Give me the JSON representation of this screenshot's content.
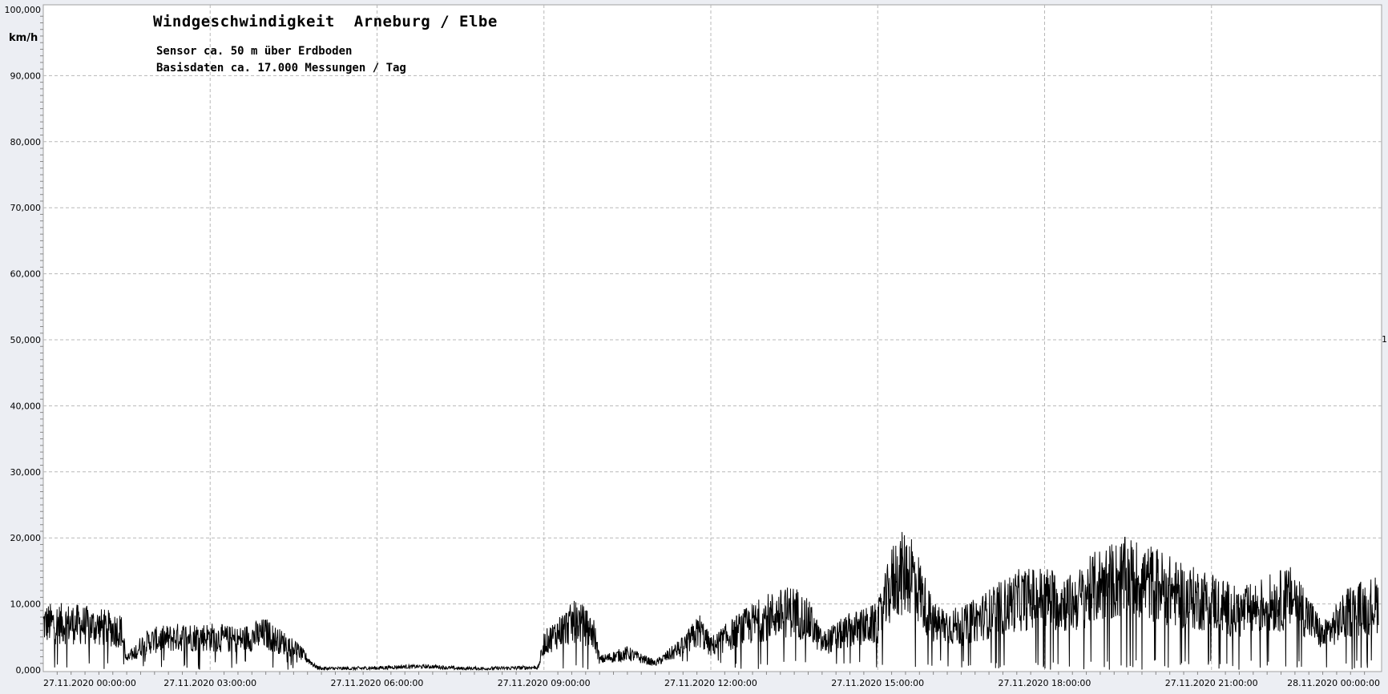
{
  "chart_data": {
    "type": "line",
    "title": "Windgeschwindigkeit  Arneburg / Elbe",
    "subtitle_lines": [
      "Sensor ca. 50 m über Erdboden",
      "Basisdaten ca. 17.000 Messungen / Tag"
    ],
    "ylabel": "km/h",
    "ylim": [
      0,
      100
    ],
    "y_ticks": [
      "0,000",
      "10,000",
      "20,000",
      "30,000",
      "40,000",
      "50,000",
      "60,000",
      "70,000",
      "80,000",
      "90,000",
      "100,000"
    ],
    "x_ticks": [
      "27.11.2020  00:00:00",
      "27.11.2020  03:00:00",
      "27.11.2020  06:00:00",
      "27.11.2020  09:00:00",
      "27.11.2020  12:00:00",
      "27.11.2020  15:00:00",
      "27.11.2020  18:00:00",
      "27.11.2020  21:00:00",
      "28.11.2020  00:00:00"
    ],
    "xlim_hours": [
      0,
      24
    ],
    "grid": true,
    "right_axis_marker": "1",
    "series": [
      {
        "color": "#000000",
        "x_hours": [
          0,
          0.5,
          1,
          1.4,
          1.5,
          1.8,
          2,
          2.5,
          3,
          3.5,
          4,
          4.2,
          4.5,
          4.9,
          5,
          5.5,
          6,
          6.5,
          7,
          7.5,
          8,
          8.5,
          8.9,
          9,
          9.3,
          9.6,
          9.9,
          10,
          10.5,
          11,
          11.5,
          11.8,
          12,
          12.5,
          13,
          13.5,
          13.8,
          14,
          14.5,
          15,
          15.3,
          15.6,
          16,
          16.5,
          17,
          17.5,
          18,
          18.5,
          19,
          19.5,
          20,
          20.5,
          21,
          21.5,
          22,
          22.5,
          23,
          23.5,
          24
        ],
        "values": [
          7,
          7,
          6.5,
          6,
          1.5,
          4,
          4.5,
          5,
          5,
          4.5,
          5.5,
          4.5,
          3.5,
          0.5,
          0.2,
          0.2,
          0.3,
          0.5,
          0.5,
          0.2,
          0.2,
          0.3,
          0.4,
          4,
          6,
          7.5,
          5.5,
          1.5,
          2.5,
          1,
          3.5,
          6,
          3.5,
          6,
          8,
          9,
          7,
          4,
          6,
          7,
          14,
          15,
          7,
          6.5,
          8.5,
          10.5,
          11,
          10,
          13,
          14,
          13,
          11,
          10.5,
          8.5,
          10,
          11,
          5,
          9,
          10
        ]
      }
    ]
  }
}
